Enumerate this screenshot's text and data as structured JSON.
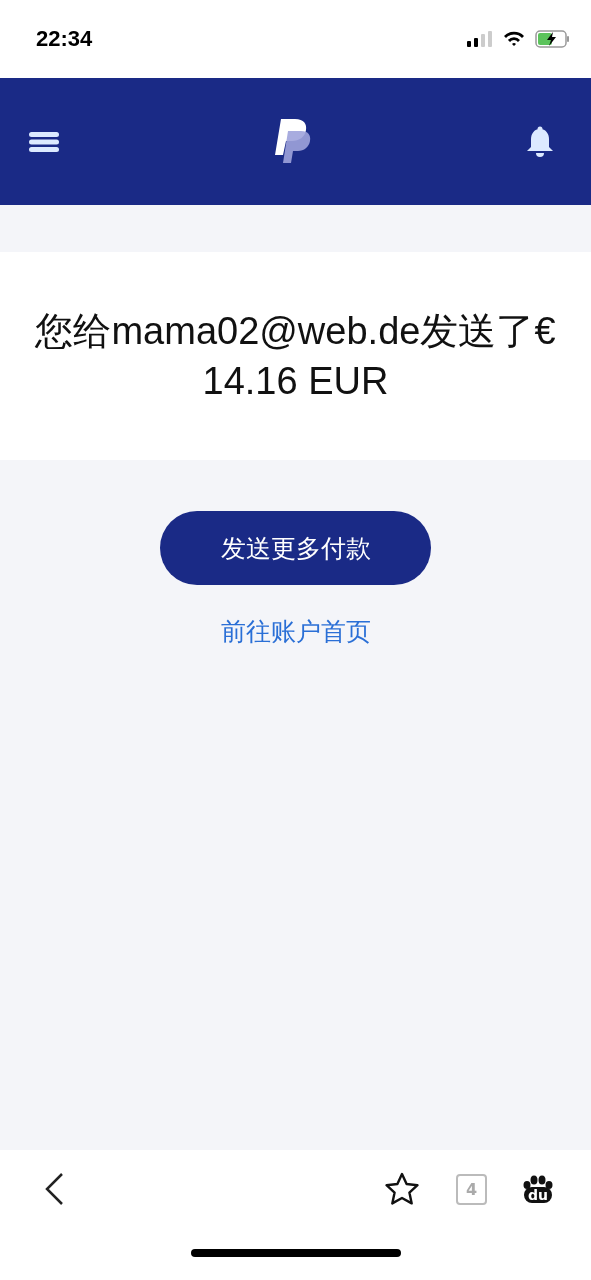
{
  "status_bar": {
    "time": "22:34"
  },
  "message": {
    "title": "您给mama02@web.de发送了€ 14.16 EUR"
  },
  "actions": {
    "primary": "发送更多付款",
    "link": "前往账户首页"
  },
  "browser_bar": {
    "tab_count": "4",
    "logo_text": "du"
  }
}
